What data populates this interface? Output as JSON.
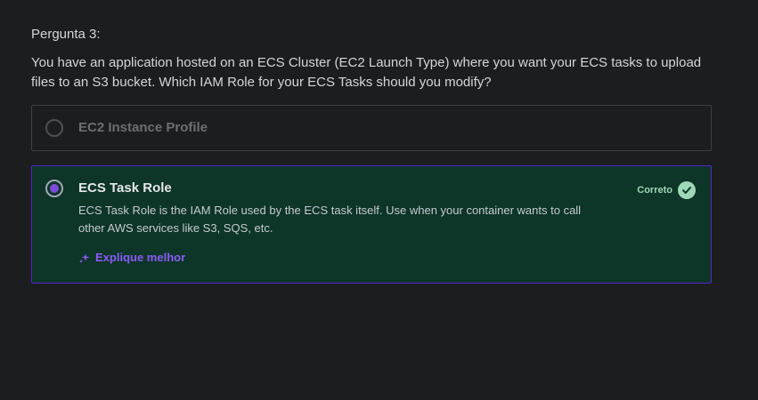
{
  "question": {
    "label": "Pergunta 3:",
    "text": "You have an application hosted on an ECS Cluster (EC2 Launch Type) where you want your ECS tasks to upload files to an S3 bucket. Which IAM Role for your ECS Tasks should you modify?"
  },
  "options": [
    {
      "title": "EC2 Instance Profile",
      "selected": false
    },
    {
      "title": "ECS Task Role",
      "selected": true,
      "description": "ECS Task Role is the IAM Role used by the ECS task itself. Use when your container wants to call other AWS services like S3, SQS, etc.",
      "result_label": "Correto",
      "explain_label": "Explique melhor"
    }
  ],
  "colors": {
    "background": "#1c1d1f",
    "correct_bg": "#0d3528",
    "accent": "#5624d0",
    "correct_text": "#9ed8b7"
  },
  "icons": [
    "radio-unselected",
    "radio-selected",
    "check-circle-icon",
    "sparkle-icon"
  ]
}
